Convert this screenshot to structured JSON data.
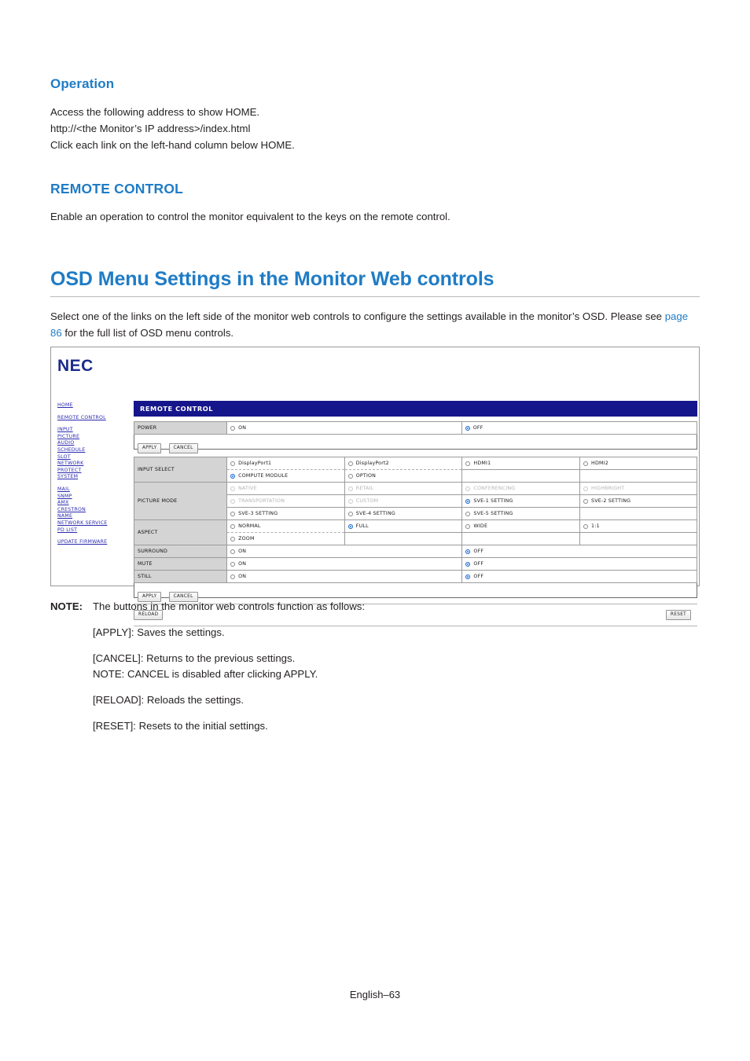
{
  "document": {
    "section_operation": {
      "heading": "Operation",
      "lines": [
        "Access the following address to show HOME.",
        "http://<the Monitor’s IP address>/index.html",
        "Click each link on the left-hand column below HOME."
      ]
    },
    "section_remote_control": {
      "heading": "REMOTE CONTROL",
      "paragraph": "Enable an operation to control the monitor equivalent to the keys on the remote control."
    },
    "section_osd": {
      "heading": "OSD Menu Settings in the Monitor Web controls",
      "intro_part1": "Select one of the links on the left side of the monitor web controls to configure the settings available in the monitor’s OSD. Please see ",
      "intro_link": "page 86",
      "intro_part2": " for the full list of OSD menu controls.",
      "menu_list": "[INPUT], [PICTURE], [AUDIO], [SCHEDULE], [SLOT], [PROTECT], [SYSTEM], [NETWORK]"
    },
    "note": {
      "tag": "NOTE:",
      "lead": "The buttons in the monitor web controls function as follows:",
      "items": [
        {
          "main": "[APPLY]: Saves the settings.",
          "sub": ""
        },
        {
          "main": "[CANCEL]: Returns to the previous settings.",
          "sub": "NOTE: CANCEL is disabled after clicking APPLY."
        },
        {
          "main": "[RELOAD]: Reloads the settings.",
          "sub": ""
        },
        {
          "main": "[RESET]: Resets to the initial settings.",
          "sub": ""
        }
      ]
    },
    "footer": "English–63"
  },
  "screenshot": {
    "logo": "NEC",
    "nav": {
      "group1": [
        "HOME"
      ],
      "group2": [
        "REMOTE CONTROL"
      ],
      "group3": [
        "INPUT",
        "PICTURE",
        "AUDIO",
        "SCHEDULE",
        "SLOT",
        "NETWORK",
        "PROTECT",
        "SYSTEM"
      ],
      "group4": [
        "MAIL",
        "SNMP",
        "AMX",
        "CRESTRON",
        "NAME",
        "NETWORK SERVICE",
        "PD LIST"
      ],
      "group5": [
        "UPDATE FIRMWARE"
      ]
    },
    "panel_title": "REMOTE CONTROL",
    "buttons": {
      "apply": "APPLY",
      "cancel": "CANCEL",
      "reload": "RELOAD",
      "reset": "RESET"
    },
    "rows": {
      "power": {
        "label": "POWER",
        "options": [
          {
            "label": "ON",
            "selected": false,
            "disabled": false
          },
          {
            "label": "OFF",
            "selected": true,
            "disabled": false
          }
        ]
      },
      "input_select": {
        "label": "INPUT SELECT",
        "line1": [
          {
            "label": "DisplayPort1",
            "selected": false,
            "disabled": false
          },
          {
            "label": "DisplayPort2",
            "selected": false,
            "disabled": false
          },
          {
            "label": "HDMI1",
            "selected": false,
            "disabled": false
          },
          {
            "label": "HDMI2",
            "selected": false,
            "disabled": false
          }
        ],
        "line2": [
          {
            "label": "COMPUTE MODULE",
            "selected": true,
            "disabled": false
          },
          {
            "label": "OPTION",
            "selected": false,
            "disabled": false
          }
        ]
      },
      "picture_mode": {
        "label": "PICTURE MODE",
        "line1": [
          {
            "label": "NATIVE",
            "selected": false,
            "disabled": true
          },
          {
            "label": "RETAIL",
            "selected": false,
            "disabled": true
          },
          {
            "label": "CONFERENCING",
            "selected": false,
            "disabled": true
          },
          {
            "label": "HIGHBRIGHT",
            "selected": false,
            "disabled": true
          }
        ],
        "line2": [
          {
            "label": "TRANSPORTATION",
            "selected": false,
            "disabled": true
          },
          {
            "label": "CUSTOM",
            "selected": false,
            "disabled": true
          },
          {
            "label": "SVE-1 SETTING",
            "selected": true,
            "disabled": false
          },
          {
            "label": "SVE-2 SETTING",
            "selected": false,
            "disabled": false
          }
        ],
        "line3": [
          {
            "label": "SVE-3 SETTING",
            "selected": false,
            "disabled": false
          },
          {
            "label": "SVE-4 SETTING",
            "selected": false,
            "disabled": false
          },
          {
            "label": "SVE-5 SETTING",
            "selected": false,
            "disabled": false
          }
        ]
      },
      "aspect": {
        "label": "ASPECT",
        "line1": [
          {
            "label": "NORMAL",
            "selected": false,
            "disabled": false
          },
          {
            "label": "FULL",
            "selected": true,
            "disabled": false
          },
          {
            "label": "WIDE",
            "selected": false,
            "disabled": false
          },
          {
            "label": "1:1",
            "selected": false,
            "disabled": false
          }
        ],
        "line2": [
          {
            "label": "ZOOM",
            "selected": false,
            "disabled": false
          }
        ]
      },
      "surround": {
        "label": "SURROUND",
        "options": [
          {
            "label": "ON",
            "selected": false,
            "disabled": false
          },
          {
            "label": "OFF",
            "selected": true,
            "disabled": false
          }
        ]
      },
      "mute": {
        "label": "MUTE",
        "options": [
          {
            "label": "ON",
            "selected": false,
            "disabled": false
          },
          {
            "label": "OFF",
            "selected": true,
            "disabled": false
          }
        ]
      },
      "still": {
        "label": "STILL",
        "options": [
          {
            "label": "ON",
            "selected": false,
            "disabled": false
          },
          {
            "label": "OFF",
            "selected": true,
            "disabled": false
          }
        ]
      }
    },
    "colors": {
      "panel_header": "#16168c",
      "logo": "#1c2b8c",
      "link": "#2a2ab0",
      "radio_selected": "#1b7fe0",
      "label_cell": "#d4d4d4"
    }
  }
}
